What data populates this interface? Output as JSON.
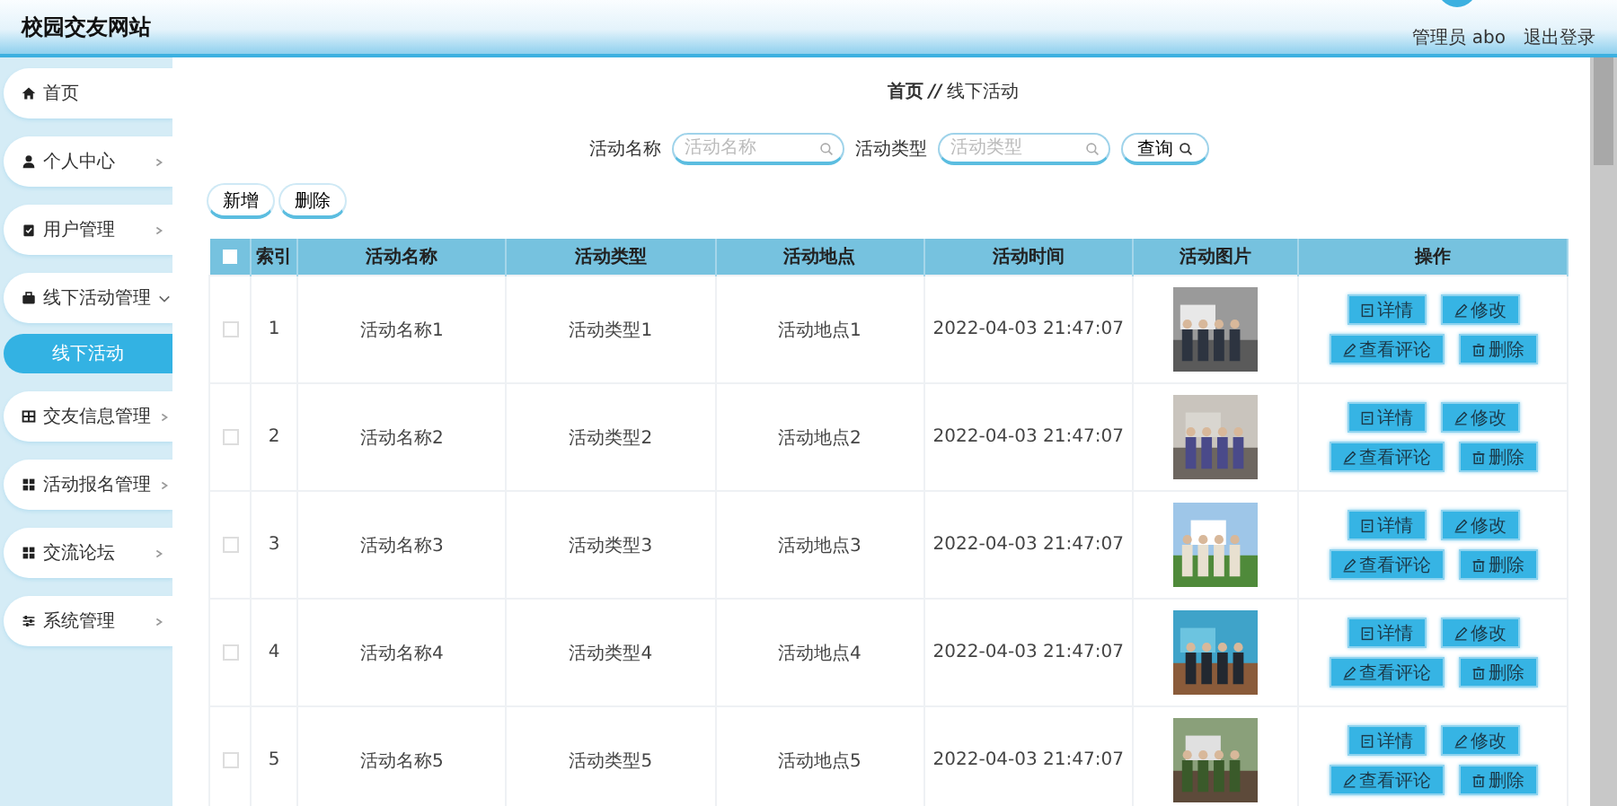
{
  "header": {
    "title": "校园交友网站",
    "user": "管理员 abo",
    "logout": "退出登录"
  },
  "sidebar": {
    "items": [
      {
        "label": "首页"
      },
      {
        "label": "个人中心",
        "expanded": false
      },
      {
        "label": "用户管理",
        "expanded": false
      },
      {
        "label": "线下活动管理",
        "expanded": true,
        "children": [
          {
            "label": "线下活动",
            "selected": true
          }
        ]
      },
      {
        "label": "交友信息管理",
        "expanded": false
      },
      {
        "label": "活动报名管理",
        "expanded": false
      },
      {
        "label": "交流论坛",
        "expanded": false
      },
      {
        "label": "系统管理",
        "expanded": false
      }
    ]
  },
  "breadcrumb": [
    "首页",
    "//",
    "线下活动"
  ],
  "search": {
    "fields": [
      {
        "label": "活动名称",
        "placeholder": "活动名称"
      },
      {
        "label": "活动类型",
        "placeholder": "活动类型"
      }
    ],
    "button": "查询"
  },
  "toolbar": [
    "新增",
    "删除"
  ],
  "table": {
    "header_checked": false,
    "columns": [
      "索引",
      "活动名称",
      "活动类型",
      "活动地点",
      "活动时间",
      "活动图片",
      "操作"
    ],
    "rows": [
      {
        "checked": false,
        "cells": [
          "1",
          "活动名称1",
          "活动类型1",
          "活动地点1",
          "2022-04-03 21:47:07"
        ],
        "actions": [
          "详情",
          "修改",
          "查看评论",
          "删除"
        ]
      },
      {
        "checked": false,
        "cells": [
          "2",
          "活动名称2",
          "活动类型2",
          "活动地点2",
          "2022-04-03 21:47:07"
        ],
        "actions": [
          "详情",
          "修改",
          "查看评论",
          "删除"
        ]
      },
      {
        "checked": false,
        "cells": [
          "3",
          "活动名称3",
          "活动类型3",
          "活动地点3",
          "2022-04-03 21:47:07"
        ],
        "actions": [
          "详情",
          "修改",
          "查看评论",
          "删除"
        ]
      },
      {
        "checked": false,
        "cells": [
          "4",
          "活动名称4",
          "活动类型4",
          "活动地点4",
          "2022-04-03 21:47:07"
        ],
        "actions": [
          "详情",
          "修改",
          "查看评论",
          "删除"
        ]
      },
      {
        "checked": false,
        "cells": [
          "5",
          "活动名称5",
          "活动类型5",
          "活动地点5",
          "2022-04-03 21:47:07"
        ],
        "actions": [
          "详情",
          "修改",
          "查看评论",
          "删除"
        ]
      }
    ]
  }
}
